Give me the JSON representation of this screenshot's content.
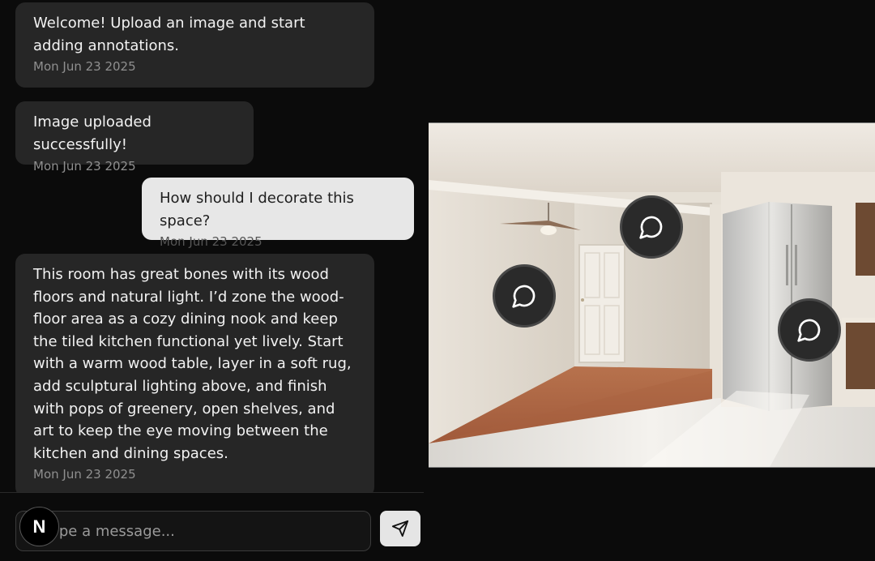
{
  "chat": {
    "messages": [
      {
        "role": "assistant",
        "text": "Welcome! Upload an image and start adding annotations.",
        "date": "Mon Jun 23 2025"
      },
      {
        "role": "assistant",
        "text": "Image uploaded successfully!",
        "date": "Mon Jun 23 2025"
      },
      {
        "role": "user",
        "text": "How should I decorate this space?",
        "date": "Mon Jun 23 2025"
      },
      {
        "role": "assistant",
        "text": "This room has great bones with its wood floors and natural light. I’d zone the wood-floor area as a cozy dining nook and keep the tiled kitchen functional yet lively. Start with a warm wood table, layer in a soft rug, add sculptural lighting above, and finish with pops of greenery, open shelves, and art to keep the eye moving between the kitchen and dining spaces.",
        "date": "Mon Jun 23 2025"
      }
    ]
  },
  "composer": {
    "placeholder": "Type a message...",
    "value": "",
    "send_icon": "send-icon"
  },
  "brand": {
    "letter": "N"
  },
  "image_panel": {
    "annotation_icon": "message-circle-icon",
    "annotation_count": 3
  }
}
